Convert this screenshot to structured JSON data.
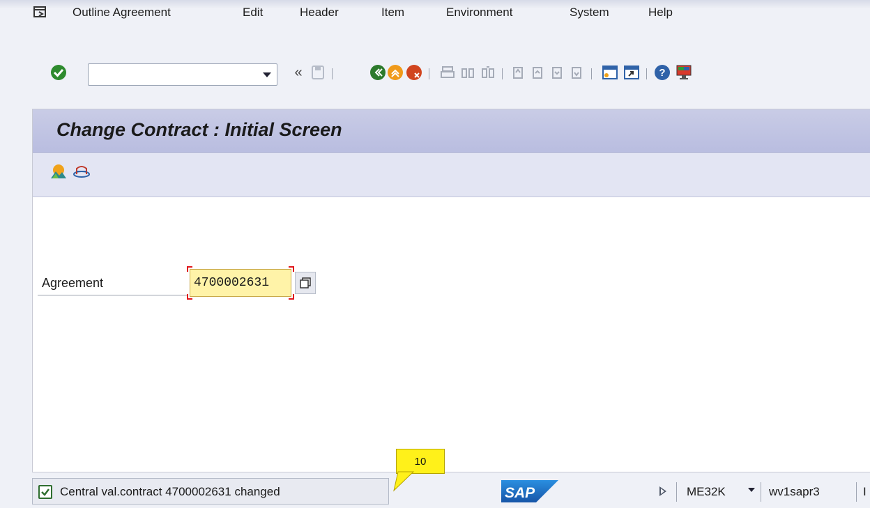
{
  "menu": {
    "items": [
      {
        "label": "Outline Agreement"
      },
      {
        "label": "Edit"
      },
      {
        "label": "Header"
      },
      {
        "label": "Item"
      },
      {
        "label": "Environment"
      },
      {
        "label": "System"
      },
      {
        "label": "Help"
      }
    ]
  },
  "toolbar": {
    "command_field_value": "",
    "icons": [
      "enter-icon",
      "collapse-icon",
      "save-icon",
      "back-icon",
      "exit-icon",
      "cancel-icon",
      "print-icon",
      "find-icon",
      "find-next-icon",
      "first-page-icon",
      "previous-page-icon",
      "next-page-icon",
      "last-page-icon",
      "create-session-icon",
      "shortcut-icon",
      "help-icon",
      "customize-layout-icon"
    ]
  },
  "screen": {
    "title": "Change Contract : Initial Screen",
    "app_toolbar_icons": [
      "mountain-icon",
      "hat-icon"
    ]
  },
  "form": {
    "agreement_label": "Agreement",
    "agreement_value": "4700002631"
  },
  "status": {
    "message": "Central val.contract 4700002631 changed",
    "callout_number": "10",
    "logo_text": "SAP",
    "transaction": "ME32K",
    "server": "wv1sapr3",
    "trailing": "I"
  },
  "colors": {
    "title_bar": "#c9cce6",
    "input_highlight": "#fff3a8",
    "callout": "#fff11a",
    "success_green": "#2f6e2f",
    "sap_blue": "#1b66b8"
  }
}
